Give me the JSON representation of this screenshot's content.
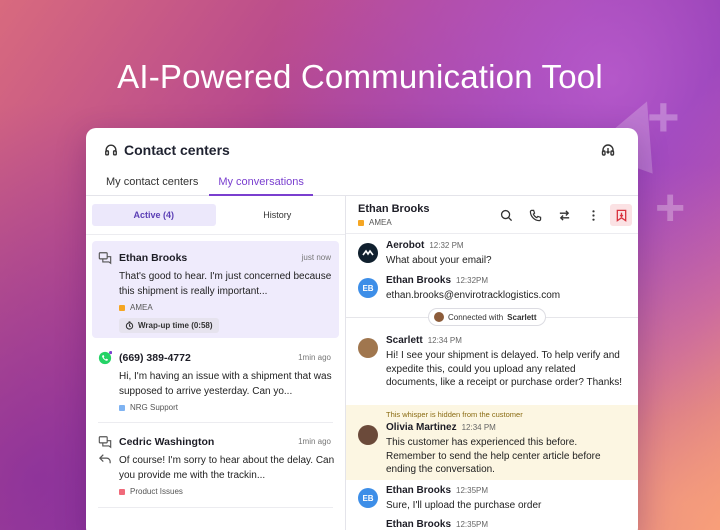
{
  "hero": {
    "title": "AI-Powered Communication Tool"
  },
  "panel": {
    "title": "Contact centers",
    "tabs": [
      {
        "label": "My contact centers",
        "active": false
      },
      {
        "label": "My conversations",
        "active": true
      }
    ]
  },
  "segments": {
    "active_label": "Active (4)",
    "history_label": "History"
  },
  "conversations": [
    {
      "name": "Ethan Brooks",
      "time": "just now",
      "message": "That's good to hear. I'm just concerned because this shipment is really important...",
      "tag": "AMEA",
      "tag_color": "#f5a623",
      "badge": "Wrap-up time (0:58)"
    },
    {
      "name": "(669) 389-4772",
      "time": "1min ago",
      "message": "Hi, I'm having an issue with a shipment that was supposed to arrive yesterday. Can yo...",
      "tag": "NRG Support",
      "tag_color": "#7fb3f2"
    },
    {
      "name": "Cedric Washington",
      "time": "1min ago",
      "message": "Of course! I'm sorry to hear about the delay. Can you provide me with the trackin...",
      "tag": "Product Issues",
      "tag_color": "#f06a7a"
    }
  ],
  "chat": {
    "contact_name": "Ethan Brooks",
    "region": "AMEA",
    "region_color": "#f5a623",
    "connected_text": "Connected with",
    "connected_name": "Scarlett",
    "whisper_note": "This whisper is hidden from the customer",
    "messages": [
      {
        "sender": "Aerobot",
        "time": "12:32 PM",
        "text": "What about your email?"
      },
      {
        "sender": "Ethan Brooks",
        "initials": "EB",
        "time": "12:32PM",
        "text": "ethan.brooks@envirotracklogistics.com"
      },
      {
        "sender": "Scarlett",
        "time": "12:34 PM",
        "text": "Hi! I see your shipment is delayed. To help verify and expedite this, could you upload any related documents, like a receipt or purchase order? Thanks!"
      },
      {
        "sender": "Olivia Martinez",
        "time": "12:34 PM",
        "text": "This customer has experienced this before. Remember to send the help center article before ending the conversation."
      },
      {
        "sender": "Ethan Brooks",
        "initials": "EB",
        "time": "12:35PM",
        "text": "Sure, I'll upload the purchase order"
      },
      {
        "sender": "Ethan Brooks",
        "initials": "EB",
        "time": "12:35PM",
        "text": ""
      }
    ]
  }
}
